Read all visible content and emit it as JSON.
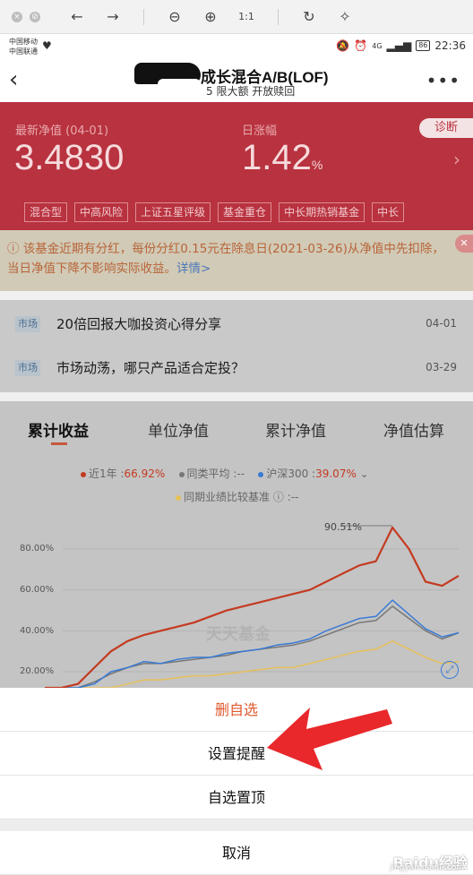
{
  "browser": {
    "icons": [
      "close-icon",
      "stop-icon",
      "back-arrow-icon",
      "forward-arrow-icon",
      "zoom-out-icon",
      "zoom-in-icon",
      "actual-size-icon",
      "rotate-icon",
      "magic-wand-icon"
    ]
  },
  "status_bar": {
    "carrier1": "中国移动",
    "carrier2": "中国联通",
    "signal": "4G",
    "battery": "86",
    "time": "22:36"
  },
  "header": {
    "title": "成长混合A/B(LOF)",
    "subtitle": "5 限大额 开放赎回",
    "more": "•••"
  },
  "nav": {
    "nav_label": "最新净值 (04-01)",
    "nav_value": "3.4830",
    "change_label": "日涨幅",
    "change_value": "1.42",
    "change_unit": "%",
    "diagnose_label": "诊断",
    "tags": [
      "混合型",
      "中高风险",
      "上证五星评级",
      "基金重仓",
      "中长期热销基金",
      "中长"
    ]
  },
  "notice": {
    "text": "该基金近期有分红，每份分红0.15元在除息日(2021-03-26)从净值中先扣除，当日净值下降不影响实际收益。",
    "link": "详情>"
  },
  "news": [
    {
      "tag": "市场",
      "title": "20倍回报大咖投资心得分享",
      "date": "04-01"
    },
    {
      "tag": "市场",
      "title": "市场动荡，哪只产品适合定投？",
      "date": "03-29"
    }
  ],
  "chart": {
    "tabs": [
      "累计收益",
      "单位净值",
      "累计净值",
      "净值估算"
    ],
    "active_tab": 0,
    "legend": {
      "fund_label": "近1年 :",
      "fund_value": "66.92%",
      "peer_label": "同类平均 :",
      "peer_value": "--",
      "index_label": "沪深300 :",
      "index_value": "39.07%",
      "benchmark_label": "同期业绩比较基准"
    },
    "yticks": [
      "80.00%",
      "60.00%",
      "40.00%",
      "20.00%"
    ],
    "peak_label": "90.51%",
    "watermark": "天天基金"
  },
  "chart_data": {
    "type": "line",
    "title": "",
    "xlabel": "",
    "ylabel": "",
    "ylim": [
      10,
      95
    ],
    "series": [
      {
        "name": "近1年",
        "color": "#c43a20",
        "values": [
          5,
          8,
          14,
          22,
          30,
          35,
          38,
          40,
          42,
          44,
          47,
          50,
          52,
          54,
          56,
          58,
          60,
          64,
          68,
          72,
          74,
          90.51,
          80,
          64,
          62,
          66.92
        ]
      },
      {
        "name": "同类平均",
        "color": "#777777",
        "values": [
          3,
          5,
          10,
          15,
          19,
          22,
          24,
          24,
          25,
          26,
          27,
          28,
          30,
          31,
          32,
          33,
          35,
          38,
          41,
          44,
          45,
          52,
          46,
          40,
          36,
          39
        ]
      },
      {
        "name": "沪深300",
        "color": "#3a7bd5",
        "values": [
          2,
          4,
          9,
          14,
          20,
          22,
          25,
          24,
          26,
          27,
          27,
          29,
          30,
          31,
          33,
          34,
          36,
          40,
          43,
          46,
          47,
          55,
          48,
          41,
          37,
          39.07
        ]
      },
      {
        "name": "同期业绩比较基准",
        "color": "#e6c05a",
        "values": [
          1,
          3,
          6,
          9,
          12,
          14,
          16,
          16,
          17,
          18,
          18,
          19,
          20,
          21,
          22,
          22,
          24,
          26,
          28,
          30,
          31,
          35,
          31,
          27,
          24,
          25
        ]
      }
    ]
  },
  "sheet": {
    "delete_label": "删自选",
    "remind_label": "设置提醒",
    "pin_label": "自选置顶",
    "cancel_label": "取消"
  },
  "watermark_site": {
    "brand": "Baidu经验",
    "url": "jingyan.baidu.com"
  }
}
